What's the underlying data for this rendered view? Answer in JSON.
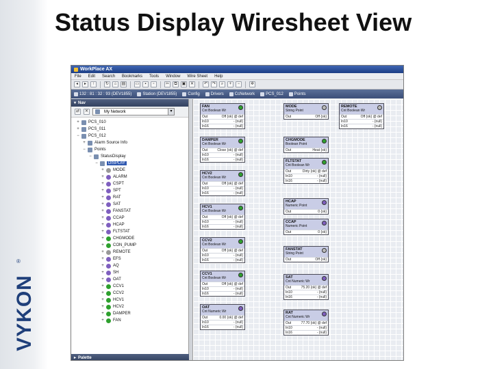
{
  "slide": {
    "title": "Status Display Wiresheet View",
    "brand": "VYKON",
    "registered": "®"
  },
  "window": {
    "title": "WorkPlace AX",
    "menu": [
      "File",
      "Edit",
      "Search",
      "Bookmarks",
      "Tools",
      "Window",
      "Wire Sheet",
      "Help"
    ],
    "path": [
      {
        "label": "132 : 81 : 32 : 93 (DEV1855)"
      },
      {
        "label": "Station (DEV1855)"
      },
      {
        "label": "Config"
      },
      {
        "label": "Drivers"
      },
      {
        "label": "CcNetwork"
      },
      {
        "label": "PCS_012"
      },
      {
        "label": "Points"
      }
    ]
  },
  "nav": {
    "header": "Nav",
    "selector": "My Network",
    "tree": [
      {
        "label": "PCS_010",
        "indent": 3,
        "exp": "+",
        "icon": "folder"
      },
      {
        "label": "PCS_011",
        "indent": 3,
        "exp": "+",
        "icon": "folder"
      },
      {
        "label": "PCS_012",
        "indent": 3,
        "exp": "−",
        "icon": "folder"
      },
      {
        "label": "Alarm Source Info",
        "indent": 4,
        "exp": "+",
        "icon": "folder"
      },
      {
        "label": "Points",
        "indent": 4,
        "exp": "−",
        "icon": "folder"
      },
      {
        "label": "StatusDisplay",
        "indent": 5,
        "exp": "−",
        "icon": "folder"
      },
      {
        "label": "DISPLAY",
        "indent": 6,
        "exp": "−",
        "icon": "folder",
        "selected": true
      },
      {
        "label": "MODE",
        "indent": 7,
        "exp": "+",
        "icon": "gry"
      },
      {
        "label": "ALARM",
        "indent": 7,
        "exp": "+",
        "icon": "pt"
      },
      {
        "label": "CSPT",
        "indent": 7,
        "exp": "+",
        "icon": "pt"
      },
      {
        "label": "SPT",
        "indent": 7,
        "exp": "+",
        "icon": "pt"
      },
      {
        "label": "RAT",
        "indent": 7,
        "exp": "+",
        "icon": "pt"
      },
      {
        "label": "SAT",
        "indent": 7,
        "exp": "+",
        "icon": "pt"
      },
      {
        "label": "FANSTAT",
        "indent": 7,
        "exp": "+",
        "icon": "pt"
      },
      {
        "label": "CCAP",
        "indent": 7,
        "exp": "+",
        "icon": "pt"
      },
      {
        "label": "HCAP",
        "indent": 7,
        "exp": "+",
        "icon": "pt"
      },
      {
        "label": "FLTSTAT",
        "indent": 7,
        "exp": "+",
        "icon": "pt"
      },
      {
        "label": "CHGMODE",
        "indent": 7,
        "exp": "+",
        "icon": "grn"
      },
      {
        "label": "CON_PUMP",
        "indent": 7,
        "exp": "+",
        "icon": "grn"
      },
      {
        "label": "REMOTE",
        "indent": 7,
        "exp": "+",
        "icon": "gry"
      },
      {
        "label": "EFS",
        "indent": 7,
        "exp": "+",
        "icon": "pt"
      },
      {
        "label": "AQ",
        "indent": 7,
        "exp": "+",
        "icon": "pt"
      },
      {
        "label": "SH",
        "indent": 7,
        "exp": "+",
        "icon": "pt"
      },
      {
        "label": "OAT",
        "indent": 7,
        "exp": "+",
        "icon": "pt"
      },
      {
        "label": "CCV1",
        "indent": 7,
        "exp": "+",
        "icon": "grn"
      },
      {
        "label": "CCV2",
        "indent": 7,
        "exp": "+",
        "icon": "grn"
      },
      {
        "label": "HCV1",
        "indent": 7,
        "exp": "+",
        "icon": "grn"
      },
      {
        "label": "HCV2",
        "indent": 7,
        "exp": "+",
        "icon": "grn"
      },
      {
        "label": "DAMPER",
        "indent": 7,
        "exp": "+",
        "icon": "grn"
      },
      {
        "label": "FAN",
        "indent": 7,
        "exp": "+",
        "icon": "grn"
      }
    ],
    "palette": "Palette"
  },
  "sheet": {
    "blocks": [
      {
        "name": "FAN",
        "type": "Cnt Boolean Wr",
        "dot": "#2ea02e",
        "col": 0,
        "row": 0,
        "slots": [
          [
            "Out",
            "Off {ok} @ def"
          ],
          [
            "In10",
            "- {null}"
          ],
          [
            "In16",
            "- {null}"
          ]
        ]
      },
      {
        "name": "DAMPER",
        "type": "Cnt Boolean Wr",
        "dot": "#2ea02e",
        "col": 0,
        "row": 1,
        "slots": [
          [
            "Out",
            "Close {ok} @ def"
          ],
          [
            "In10",
            "- {null}"
          ],
          [
            "In16",
            "- {null}"
          ]
        ]
      },
      {
        "name": "HCV2",
        "type": "Cnt Boolean Wr",
        "dot": "#2ea02e",
        "col": 0,
        "row": 2,
        "slots": [
          [
            "Out",
            "Off {ok} @ def"
          ],
          [
            "In10",
            "- {null}"
          ],
          [
            "In16",
            "- {null}"
          ]
        ]
      },
      {
        "name": "HCV1",
        "type": "Cnt Boolean Wr",
        "dot": "#2ea02e",
        "col": 0,
        "row": 3,
        "slots": [
          [
            "Out",
            "Off {ok} @ def"
          ],
          [
            "In10",
            "- {null}"
          ],
          [
            "In16",
            "- {null}"
          ]
        ]
      },
      {
        "name": "CCV2",
        "type": "Cnt Boolean Wr",
        "dot": "#2ea02e",
        "col": 0,
        "row": 4,
        "slots": [
          [
            "Out",
            "Off {ok} @ def"
          ],
          [
            "In10",
            "- {null}"
          ],
          [
            "In16",
            "- {null}"
          ]
        ]
      },
      {
        "name": "CCV1",
        "type": "Cnt Boolean Wr",
        "dot": "#2ea02e",
        "col": 0,
        "row": 5,
        "slots": [
          [
            "Out",
            "Off {ok} @ def"
          ],
          [
            "In10",
            "- {null}"
          ],
          [
            "In16",
            "- {null}"
          ]
        ]
      },
      {
        "name": "OAT",
        "type": "Cnt Numeric Wr",
        "dot": "#7f5fbf",
        "col": 0,
        "row": 6,
        "slots": [
          [
            "Out",
            "0.00 {ok} @ def"
          ],
          [
            "In10",
            "- {null}"
          ],
          [
            "In16",
            "- {null}"
          ]
        ]
      },
      {
        "name": "MODE",
        "type": "String Point",
        "dot": "#bbbbbb",
        "col": 1,
        "row": 0,
        "slots": [
          [
            "Out",
            "Off {ok}"
          ]
        ]
      },
      {
        "name": "CHGMODE",
        "type": "Boolean Point",
        "dot": "#2ea02e",
        "col": 1,
        "row": 1,
        "slots": [
          [
            "Out",
            "Heat {ok}"
          ]
        ]
      },
      {
        "name": "FLTSTAT",
        "type": "Cnt Boolean Wr",
        "dot": "#2ea02e",
        "col": 1,
        "row": 2,
        "slots": [
          [
            "Out",
            "Dirty {ok} @ def"
          ],
          [
            "In10",
            "- {null}"
          ],
          [
            "In16",
            "- {null}"
          ]
        ]
      },
      {
        "name": "HCAP",
        "type": "Numeric Point",
        "dot": "#7f5fbf",
        "col": 1,
        "row": 3,
        "slots": [
          [
            "Out",
            "0 {ok}"
          ]
        ]
      },
      {
        "name": "CCAP",
        "type": "Numeric Point",
        "dot": "#7f5fbf",
        "col": 1,
        "row": 4,
        "slots": [
          [
            "Out",
            "0 {ok}"
          ]
        ]
      },
      {
        "name": "FANSTAT",
        "type": "String Point",
        "dot": "#bbbbbb",
        "col": 1,
        "row": 5,
        "slots": [
          [
            "Out",
            "Off {ok}"
          ]
        ]
      },
      {
        "name": "SAT",
        "type": "Cnt Numeric Wr",
        "dot": "#7f5fbf",
        "col": 1,
        "row": 6,
        "slots": [
          [
            "Out",
            "75.20 {ok} @ def"
          ],
          [
            "In10",
            "- {null}"
          ],
          [
            "In16",
            "- {null}"
          ]
        ]
      },
      {
        "name": "RAT",
        "type": "Cnt Numeric Wr",
        "dot": "#7f5fbf",
        "col": 1,
        "row": 7,
        "slots": [
          [
            "Out",
            "77.70 {ok} @ def"
          ],
          [
            "In10",
            "- {null}"
          ],
          [
            "In16",
            "- {null}"
          ]
        ]
      },
      {
        "name": "REMOTE",
        "type": "Cnt Boolean Wr",
        "dot": "#bbbbbb",
        "col": 2,
        "row": 0,
        "slots": [
          [
            "Out",
            "Off {ok} @ def"
          ],
          [
            "In10",
            "- {null}"
          ],
          [
            "In16",
            "- {null}"
          ]
        ]
      }
    ]
  }
}
